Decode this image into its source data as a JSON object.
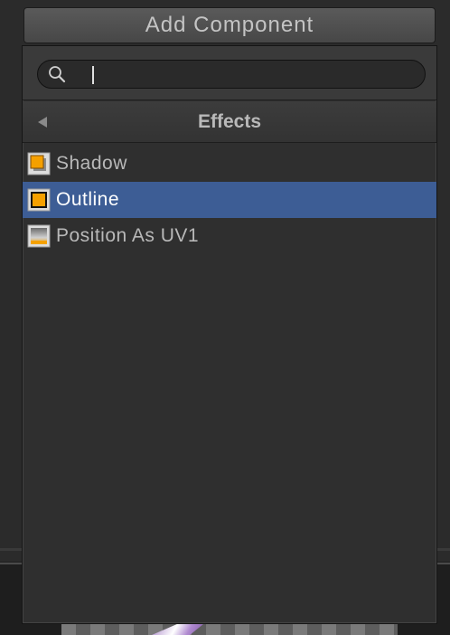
{
  "add_component": {
    "label": "Add Component"
  },
  "search": {
    "value": "",
    "placeholder": ""
  },
  "header": {
    "title": "Effects"
  },
  "items": [
    {
      "label": "Shadow",
      "icon": "shadow-effect-icon",
      "selected": false
    },
    {
      "label": "Outline",
      "icon": "outline-effect-icon",
      "selected": true
    },
    {
      "label": "Position As UV1",
      "icon": "position-as-uv1-icon",
      "selected": false
    }
  ],
  "colors": {
    "selection": "#3d5d95",
    "accent_orange": "#f5a000",
    "background": "#2f2f2f"
  }
}
